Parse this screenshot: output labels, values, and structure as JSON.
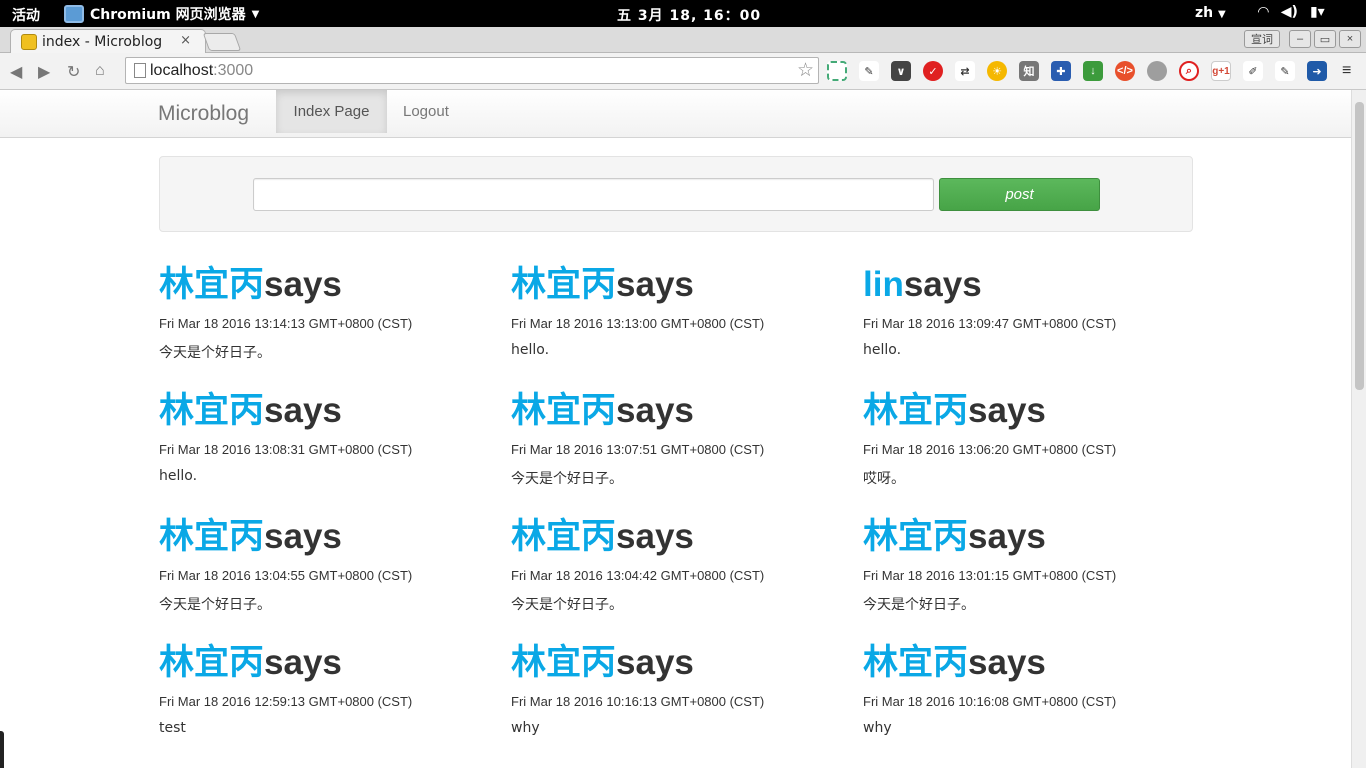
{
  "os": {
    "activities": "活动",
    "app_name": "Chromium 网页浏览器",
    "clock": "五  3月 18, 16：00",
    "lang": "zh"
  },
  "browser": {
    "tab_title": "index - Microblog",
    "tab_close": "×",
    "window_label": "宣词",
    "url_host": "localhost",
    "url_port": ":3000"
  },
  "extensions": [
    "知",
    "g+1"
  ],
  "site": {
    "brand": "Microblog",
    "nav": [
      {
        "label": "Index Page"
      },
      {
        "label": "Logout"
      }
    ],
    "post_button": "post",
    "post_input_value": ""
  },
  "posts": [
    {
      "user": "林宜丙",
      "says": "says",
      "time": "Fri Mar 18 2016 13:14:13 GMT+0800 (CST)",
      "content": "今天是个好日子。"
    },
    {
      "user": "林宜丙",
      "says": "says",
      "time": "Fri Mar 18 2016 13:13:00 GMT+0800 (CST)",
      "content": "hello."
    },
    {
      "user": "lin",
      "says": "says",
      "time": "Fri Mar 18 2016 13:09:47 GMT+0800 (CST)",
      "content": "hello."
    },
    {
      "user": "林宜丙",
      "says": "says",
      "time": "Fri Mar 18 2016 13:08:31 GMT+0800 (CST)",
      "content": "hello."
    },
    {
      "user": "林宜丙",
      "says": "says",
      "time": "Fri Mar 18 2016 13:07:51 GMT+0800 (CST)",
      "content": "今天是个好日子。"
    },
    {
      "user": "林宜丙",
      "says": "says",
      "time": "Fri Mar 18 2016 13:06:20 GMT+0800 (CST)",
      "content": "哎呀。"
    },
    {
      "user": "林宜丙",
      "says": "says",
      "time": "Fri Mar 18 2016 13:04:55 GMT+0800 (CST)",
      "content": "今天是个好日子。"
    },
    {
      "user": "林宜丙",
      "says": "says",
      "time": "Fri Mar 18 2016 13:04:42 GMT+0800 (CST)",
      "content": "今天是个好日子。"
    },
    {
      "user": "林宜丙",
      "says": "says",
      "time": "Fri Mar 18 2016 13:01:15 GMT+0800 (CST)",
      "content": "今天是个好日子。"
    },
    {
      "user": "林宜丙",
      "says": "says",
      "time": "Fri Mar 18 2016 12:59:13 GMT+0800 (CST)",
      "content": "test"
    },
    {
      "user": "林宜丙",
      "says": "says",
      "time": "Fri Mar 18 2016 10:16:13 GMT+0800 (CST)",
      "content": "why"
    },
    {
      "user": "林宜丙",
      "says": "says",
      "time": "Fri Mar 18 2016 10:16:08 GMT+0800 (CST)",
      "content": "why"
    }
  ]
}
